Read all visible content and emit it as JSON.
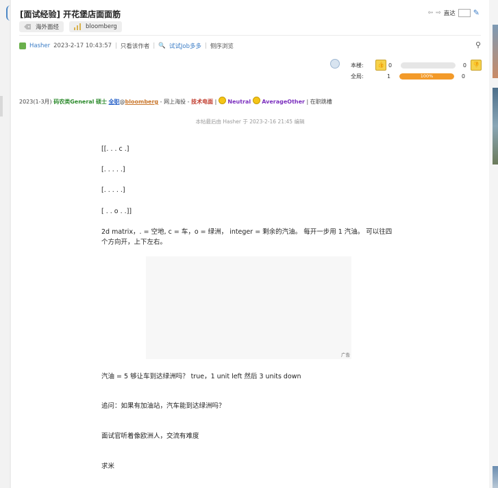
{
  "thread": {
    "title": "[面试经验] 开花堡店面面筋",
    "tags": [
      "海外面经",
      "bloomberg"
    ]
  },
  "nav": {
    "goto_label": "直达"
  },
  "meta": {
    "author": "Hasher",
    "timestamp": "2023-2-17 10:43:57",
    "only_author": "只看该作者",
    "try_job": "试试Job多多",
    "side_browse": "侧序浏览"
  },
  "rating": {
    "this_floor_label": "本楼:",
    "all_label": "全局:",
    "this_floor_up": "0",
    "this_floor_down": "0",
    "all_up": "1",
    "all_down": "0",
    "this_floor_percent": 0,
    "all_percent": 100,
    "all_percent_label": "100%"
  },
  "signature": {
    "period": "2023(1-3月)",
    "role": "码农类General",
    "degree": "硕士",
    "type": "全职",
    "at": "@",
    "company": "bloomberg",
    "channel": " - 网上海投 - ",
    "round": "技术电面",
    "sep1": " | ",
    "result": "Neutral",
    "difficulty": "AverageOther",
    "tail": " | 在职跳槽"
  },
  "edited_note": "本帖最后由 Hasher 于 2023-2-16 21:45 编辑",
  "content": {
    "row1": "[[. . . c .]",
    "row2": "[. . . . .]",
    "row3": "[. . . . .]",
    "row4": "[ . . o . .]]",
    "desc": "2d matrix，. = 空地, c = 车，o = 绿洲， integer = 剩余的汽油。 每开一步用 1 汽油。 可以往四个方向开，上下左右。",
    "ad_label": "广告",
    "q1": "汽油 = 5 够让车到达绿洲吗？ true，1 unit left 然后 3 units down",
    "q2": "追问：如果有加油站，汽车能到达绿洲吗？",
    "q3": "面试官听着像欧洲人，交流有难度",
    "q4": "求米"
  },
  "colors": {
    "accent": "#3a7cc6",
    "bar_fill": "#f39a29"
  }
}
